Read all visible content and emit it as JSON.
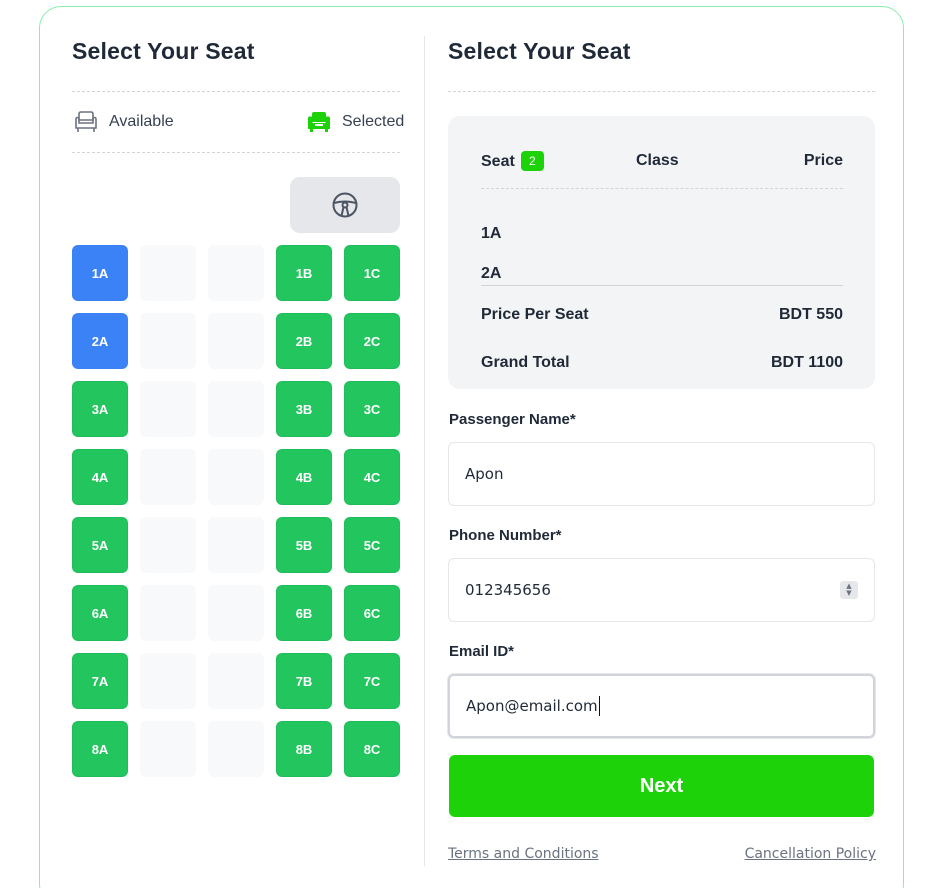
{
  "left_panel": {
    "title": "Select Your Seat",
    "legend": {
      "available_label": "Available",
      "selected_label": "Selected"
    },
    "seats": [
      {
        "label": "1A",
        "state": "selected"
      },
      {
        "label": "",
        "state": "empty"
      },
      {
        "label": "",
        "state": "empty"
      },
      {
        "label": "1B",
        "state": "available"
      },
      {
        "label": "1C",
        "state": "available"
      },
      {
        "label": "2A",
        "state": "selected"
      },
      {
        "label": "",
        "state": "empty"
      },
      {
        "label": "",
        "state": "empty"
      },
      {
        "label": "2B",
        "state": "available"
      },
      {
        "label": "2C",
        "state": "available"
      },
      {
        "label": "3A",
        "state": "available"
      },
      {
        "label": "",
        "state": "empty"
      },
      {
        "label": "",
        "state": "empty"
      },
      {
        "label": "3B",
        "state": "available"
      },
      {
        "label": "3C",
        "state": "available"
      },
      {
        "label": "4A",
        "state": "available"
      },
      {
        "label": "",
        "state": "empty"
      },
      {
        "label": "",
        "state": "empty"
      },
      {
        "label": "4B",
        "state": "available"
      },
      {
        "label": "4C",
        "state": "available"
      },
      {
        "label": "5A",
        "state": "available"
      },
      {
        "label": "",
        "state": "empty"
      },
      {
        "label": "",
        "state": "empty"
      },
      {
        "label": "5B",
        "state": "available"
      },
      {
        "label": "5C",
        "state": "available"
      },
      {
        "label": "6A",
        "state": "available"
      },
      {
        "label": "",
        "state": "empty"
      },
      {
        "label": "",
        "state": "empty"
      },
      {
        "label": "6B",
        "state": "available"
      },
      {
        "label": "6C",
        "state": "available"
      },
      {
        "label": "7A",
        "state": "available"
      },
      {
        "label": "",
        "state": "empty"
      },
      {
        "label": "",
        "state": "empty"
      },
      {
        "label": "7B",
        "state": "available"
      },
      {
        "label": "7C",
        "state": "available"
      },
      {
        "label": "8A",
        "state": "available"
      },
      {
        "label": "",
        "state": "empty"
      },
      {
        "label": "",
        "state": "empty"
      },
      {
        "label": "8B",
        "state": "available"
      },
      {
        "label": "8C",
        "state": "available"
      }
    ]
  },
  "right_panel": {
    "title": "Select Your Seat",
    "summary": {
      "seat_header": "Seat",
      "seat_count": "2",
      "class_header": "Class",
      "price_header": "Price",
      "selected_seats": [
        "1A",
        "2A"
      ],
      "price_per_seat_label": "Price Per Seat",
      "price_per_seat_value": "BDT 550",
      "grand_total_label": "Grand Total",
      "grand_total_value": "BDT 1100"
    },
    "form": {
      "name_label": "Passenger Name*",
      "name_value": "Apon",
      "phone_label": "Phone Number*",
      "phone_value": "012345656",
      "email_label": "Email ID*",
      "email_value": "Apon@email.com"
    },
    "next_label": "Next",
    "terms_link": "Terms and Conditions",
    "cancellation_link": "Cancellation Policy"
  },
  "colors": {
    "selected_seat": "#3b82f6",
    "available_seat": "#22c55e",
    "accent": "#1ed20a",
    "card_border": "#86efac"
  },
  "icons": {
    "available": "armchair-outline-icon",
    "selected": "armchair-filled-icon",
    "driver": "steering-wheel-icon"
  }
}
